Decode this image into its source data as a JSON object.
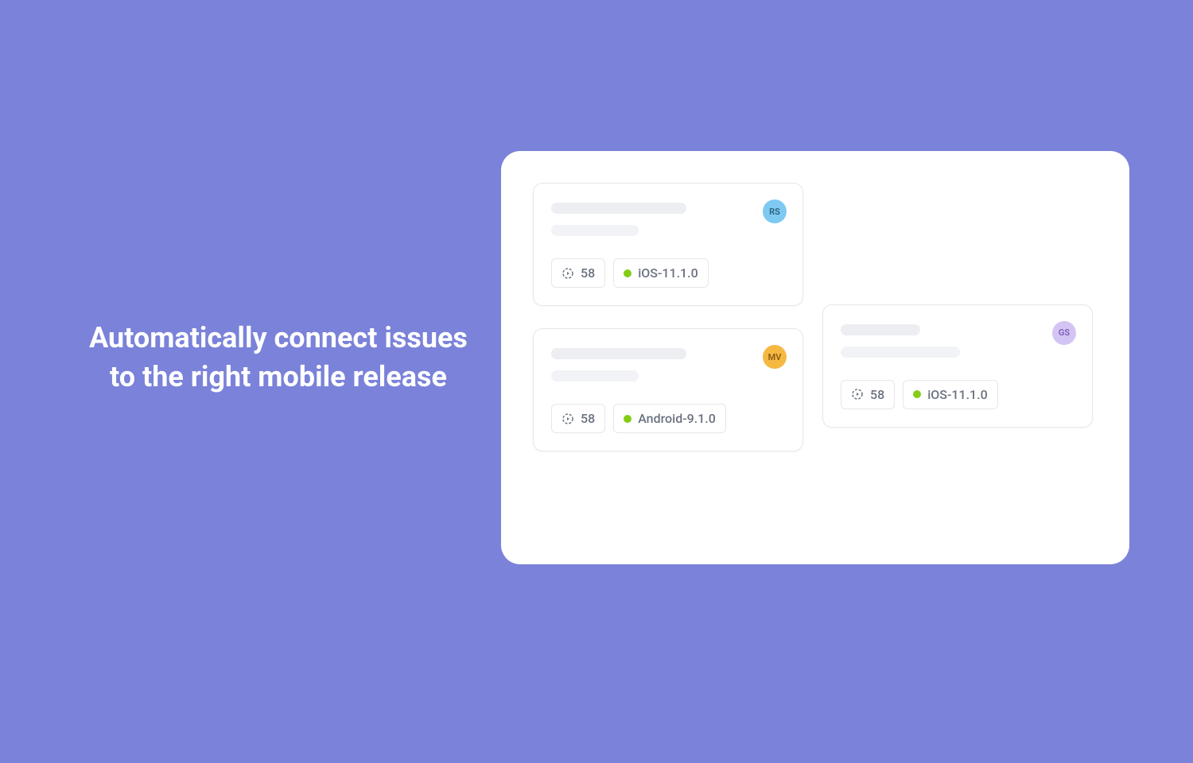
{
  "headline": "Automatically connect issues to the right mobile release",
  "cards": [
    {
      "avatar_initials": "RS",
      "cycle": "58",
      "release": "iOS-11.1.0"
    },
    {
      "avatar_initials": "MV",
      "cycle": "58",
      "release": "Android-9.1.0"
    },
    {
      "avatar_initials": "GS",
      "cycle": "58",
      "release": "iOS-11.1.0"
    }
  ],
  "colors": {
    "background": "#7a82d9",
    "dot": "#84cc16"
  }
}
